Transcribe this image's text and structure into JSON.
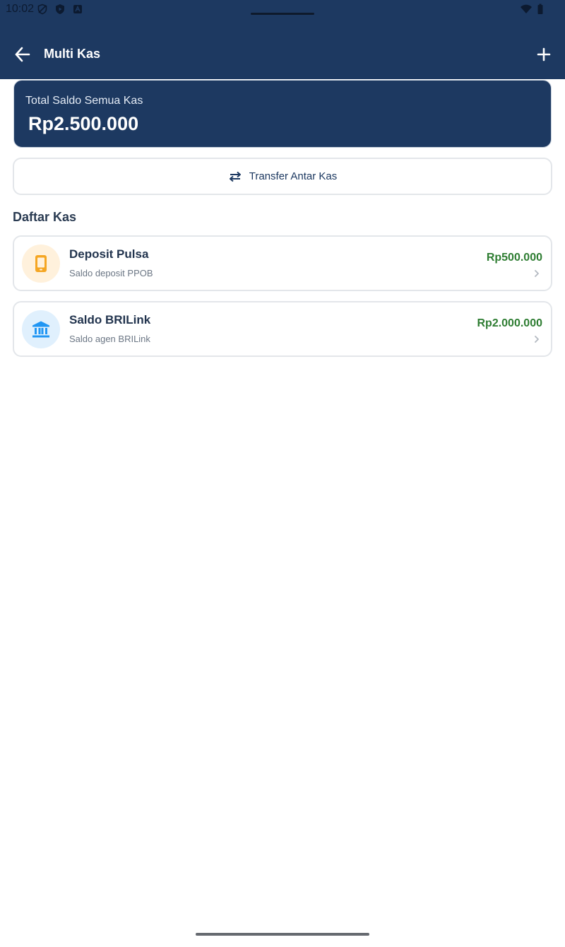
{
  "status_bar": {
    "time": "10:02"
  },
  "toolbar": {
    "title": "Multi Kas",
    "back_icon": "arrow-left-icon",
    "add_icon": "plus-icon"
  },
  "summary": {
    "label": "Total Saldo Semua Kas",
    "value": "Rp2.500.000"
  },
  "transfer_button": {
    "label": "Transfer Antar Kas",
    "icon": "swap-arrows-icon"
  },
  "section_title": "Daftar Kas",
  "kas_list": [
    {
      "name": "Deposit Pulsa",
      "description": "Saldo deposit PPOB",
      "amount": "Rp500.000",
      "icon": "smartphone-icon",
      "icon_color": "#f5a623",
      "icon_bg": "#fff1dc"
    },
    {
      "name": "Saldo BRILink",
      "description": "Saldo agen BRILink",
      "amount": "Rp2.000.000",
      "icon": "bank-icon",
      "icon_color": "#2196f3",
      "icon_bg": "#e0f0fd"
    }
  ],
  "colors": {
    "primary": "#1d3961",
    "amount_green": "#2e7d32"
  }
}
